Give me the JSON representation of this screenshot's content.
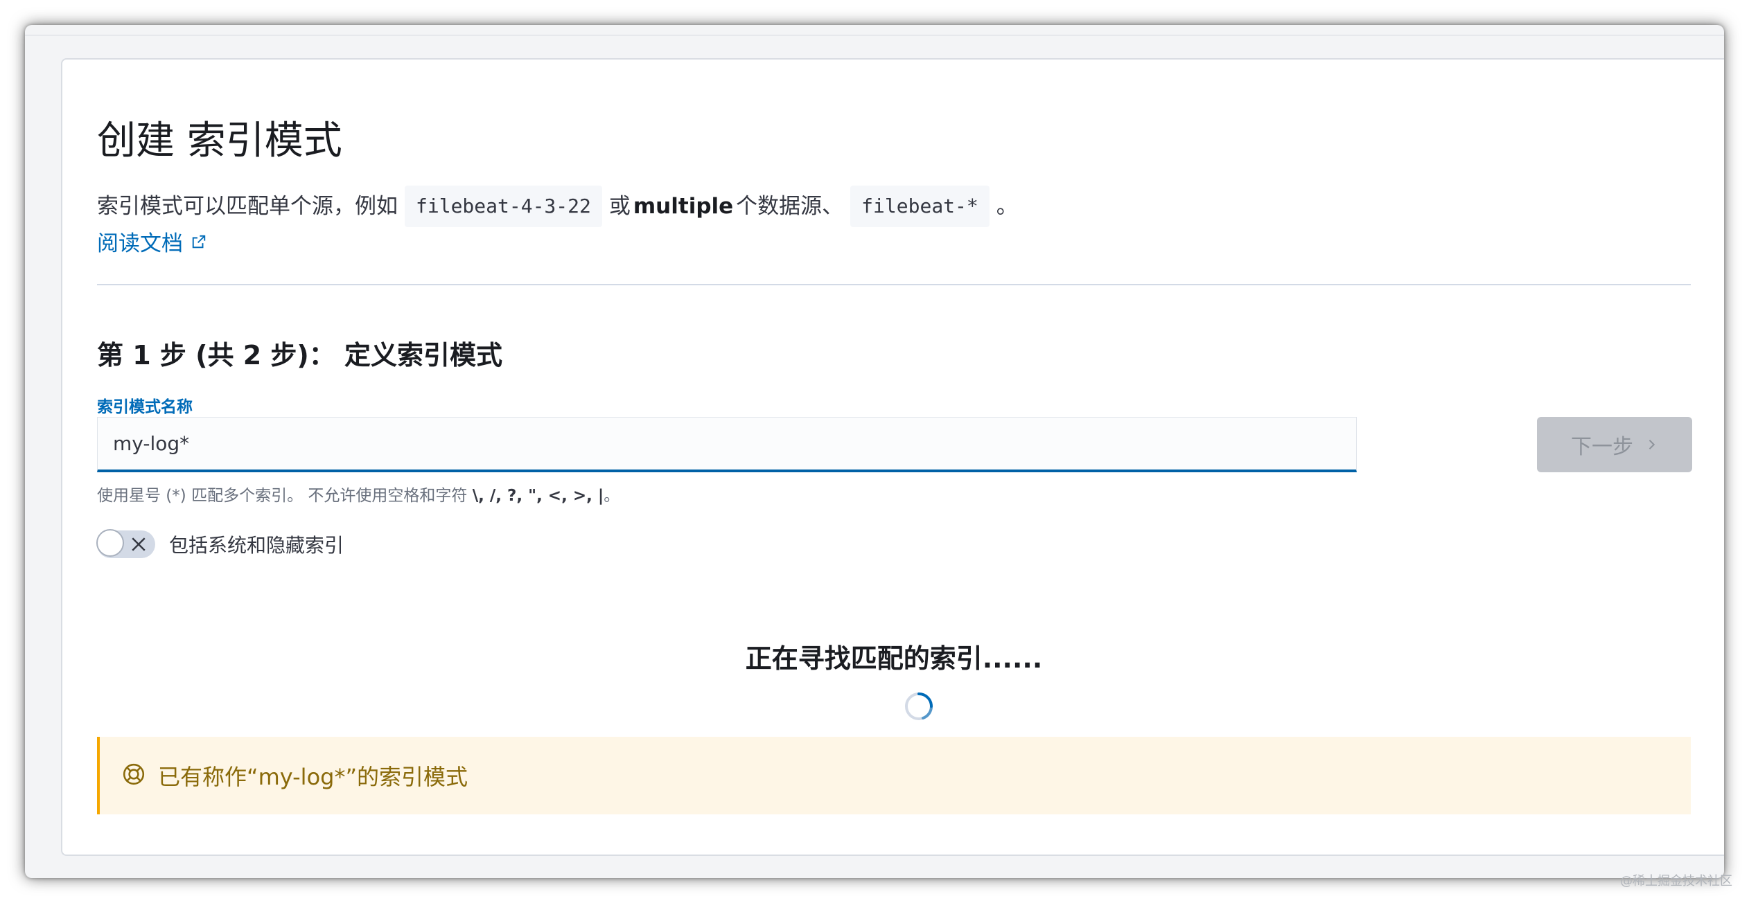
{
  "header": {
    "title": "创建 索引模式",
    "description_prefix": "索引模式可以匹配单个源，例如",
    "example_single": "filebeat-4-3-22",
    "description_or": "或",
    "description_multiple": "multiple",
    "description_middle": "个数据源、",
    "example_multiple": "filebeat-*",
    "description_suffix": "。",
    "doc_link": "阅读文档"
  },
  "step": {
    "title": "第 1 步 (共 2 步)： 定义索引模式",
    "field_label": "索引模式名称",
    "input_value": "my-log*",
    "next_button": "下一步",
    "help_prefix": "使用星号 (*) 匹配多个索引。 不允许使用空格和字符",
    "help_chars": "\\, /, ?, \", <, >, |",
    "help_suffix": "。",
    "toggle_label": "包括系统和隐藏索引",
    "toggle_on": false
  },
  "loading": {
    "text": "正在寻找匹配的索引......"
  },
  "callout": {
    "text": "已有称作“my-log*”的索引模式",
    "icon": "help-icon"
  },
  "watermark": "@稀土掘金技术社区",
  "colors": {
    "link": "#006bb8",
    "input_underline": "#0061a6",
    "callout_bg": "#fef6e6",
    "callout_border": "#f5a700",
    "callout_text": "#8a6a0a",
    "disabled_button": "#c2c5cb"
  }
}
